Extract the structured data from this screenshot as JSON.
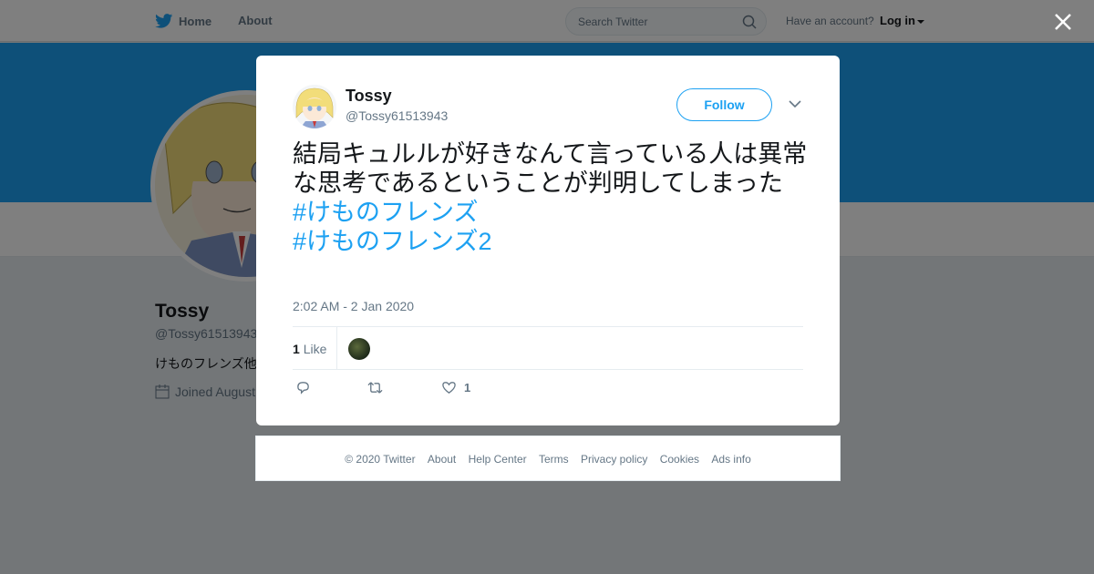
{
  "topbar": {
    "home": "Home",
    "about": "About",
    "search_placeholder": "Search Twitter",
    "account_prompt": "Have an account?",
    "login": "Log in"
  },
  "profile": {
    "name": "Tossy",
    "handle": "@Tossy61513943",
    "bio": "けものフレンズ他",
    "joined": "Joined August"
  },
  "tweet": {
    "name": "Tossy",
    "handle": "@Tossy61513943",
    "follow_label": "Follow",
    "text": "結局キュルルが好きなんて言っている人は異常な思考であるということが判明してしまった",
    "hashtags": [
      "#けものフレンズ",
      "#けものフレンズ2"
    ],
    "timestamp": "2:02 AM - 2 Jan 2020",
    "like_count": "1",
    "like_label": "Like",
    "favorite_count": "1"
  },
  "footer": {
    "links": [
      "© 2020 Twitter",
      "About",
      "Help Center",
      "Terms",
      "Privacy policy",
      "Cookies",
      "Ads info"
    ]
  },
  "colors": {
    "brand": "#1da1f2",
    "overlay": "rgba(0,0,0,0.5)",
    "text_secondary": "#657786"
  }
}
